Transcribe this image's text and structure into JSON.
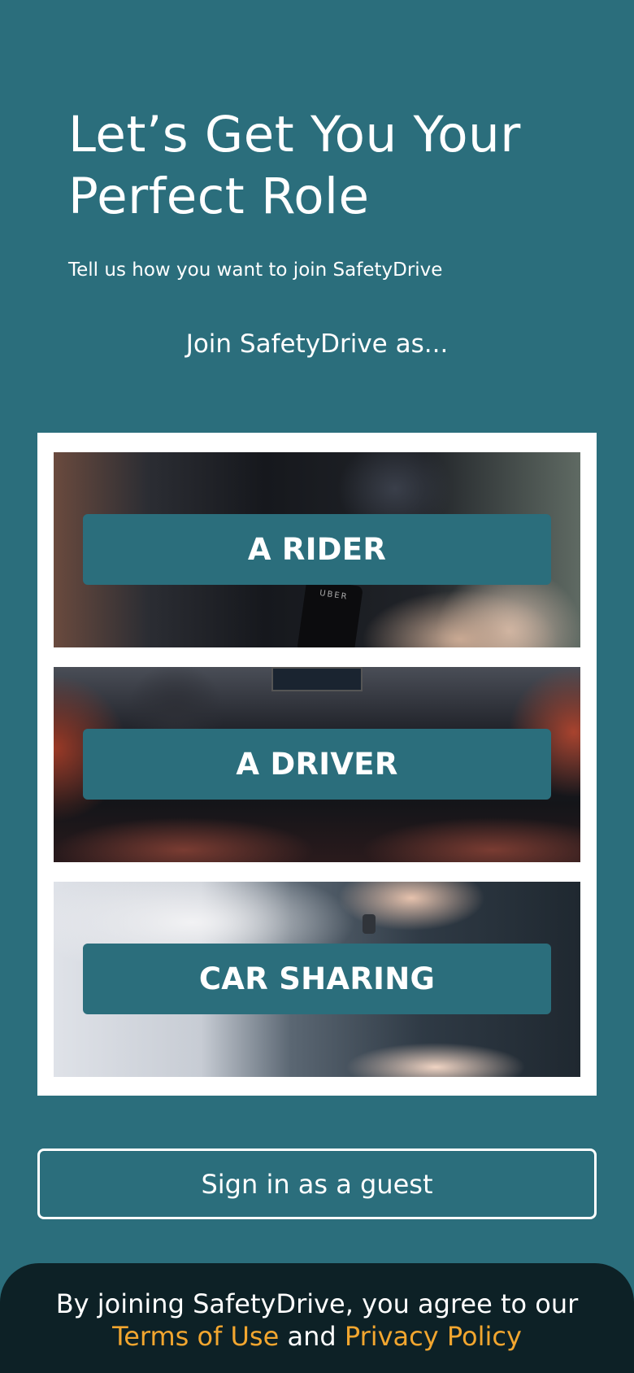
{
  "header": {
    "title_line1": "Let’s Get You Your",
    "title_line2": "Perfect Role",
    "subtitle": "Tell us how you want to join SafetyDrive"
  },
  "join_label": "Join SafetyDrive as...",
  "roles": [
    {
      "label": "A RIDER",
      "image": "rider-with-phone-in-car"
    },
    {
      "label": "A DRIVER",
      "image": "car-dashboard-interior"
    },
    {
      "label": "CAR SHARING",
      "image": "car-key-handover"
    }
  ],
  "rider_phone_text": "UBER",
  "guest_button": "Sign in as a guest",
  "footer": {
    "line1": "By joining SafetyDrive, you agree to our",
    "terms": "Terms of Use",
    "and": "and",
    "privacy": "Privacy Policy"
  },
  "colors": {
    "background": "#2b6e7c",
    "footer_background": "#0d2126",
    "link": "#f2a62f",
    "text": "#ffffff"
  }
}
